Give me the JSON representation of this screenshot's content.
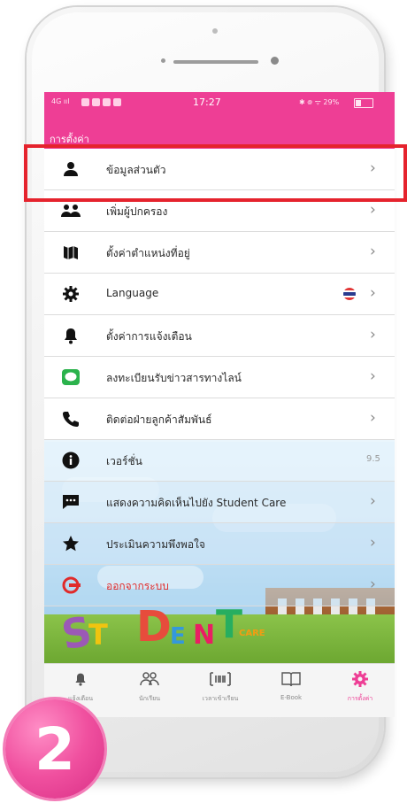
{
  "status_bar": {
    "left": "4G ııl",
    "time": "17:27",
    "right": "✱ ᪤ ᯤ 29%"
  },
  "app_bar": {
    "title": "การตั้งค่า"
  },
  "menu": [
    {
      "label": "ข้อมูลส่วนตัว",
      "icon": "person-icon"
    },
    {
      "label": "เพิ่มผู้ปกครอง",
      "icon": "group-icon"
    },
    {
      "label": "ตั้งค่าตำแหน่งที่อยู่",
      "icon": "map-icon"
    },
    {
      "label": "Language",
      "icon": "gear-icon",
      "flag": "thai-flag-icon"
    },
    {
      "label": "ตั้งค่าการแจ้งเตือน",
      "icon": "bell-icon"
    },
    {
      "label": "ลงทะเบียนรับข่าวสารทางไลน์",
      "icon": "line-icon"
    },
    {
      "label": "ติดต่อฝ่ายลูกค้าสัมพันธ์",
      "icon": "phone-icon"
    },
    {
      "label": "เวอร์ชั่น",
      "icon": "info-icon",
      "value": "9.5"
    },
    {
      "label": "แสดงความคิดเห็นไปยัง Student Care",
      "icon": "chat-icon"
    },
    {
      "label": "ประเมินความพึงพอใจ",
      "icon": "star-icon"
    },
    {
      "label": "ออกจากระบบ",
      "icon": "logout-icon"
    }
  ],
  "logo": {
    "l1": "S",
    "l2": "T",
    "l3": "D",
    "l4": "E",
    "l5": "N",
    "l6": "T",
    "l7": "CARE"
  },
  "bottom_nav": [
    {
      "label": "แจ้งเตือน",
      "icon": "bell-icon"
    },
    {
      "label": "นักเรียน",
      "icon": "students-icon"
    },
    {
      "label": "เวลาเข้าเรียน",
      "icon": "attendance-icon"
    },
    {
      "label": "E-Book",
      "icon": "book-icon"
    },
    {
      "label": "การตั้งค่า",
      "icon": "settings-icon",
      "active": true
    }
  ],
  "step_badge": "2",
  "colors": {
    "accent": "#ee3e95",
    "highlight": "#e5232d"
  }
}
